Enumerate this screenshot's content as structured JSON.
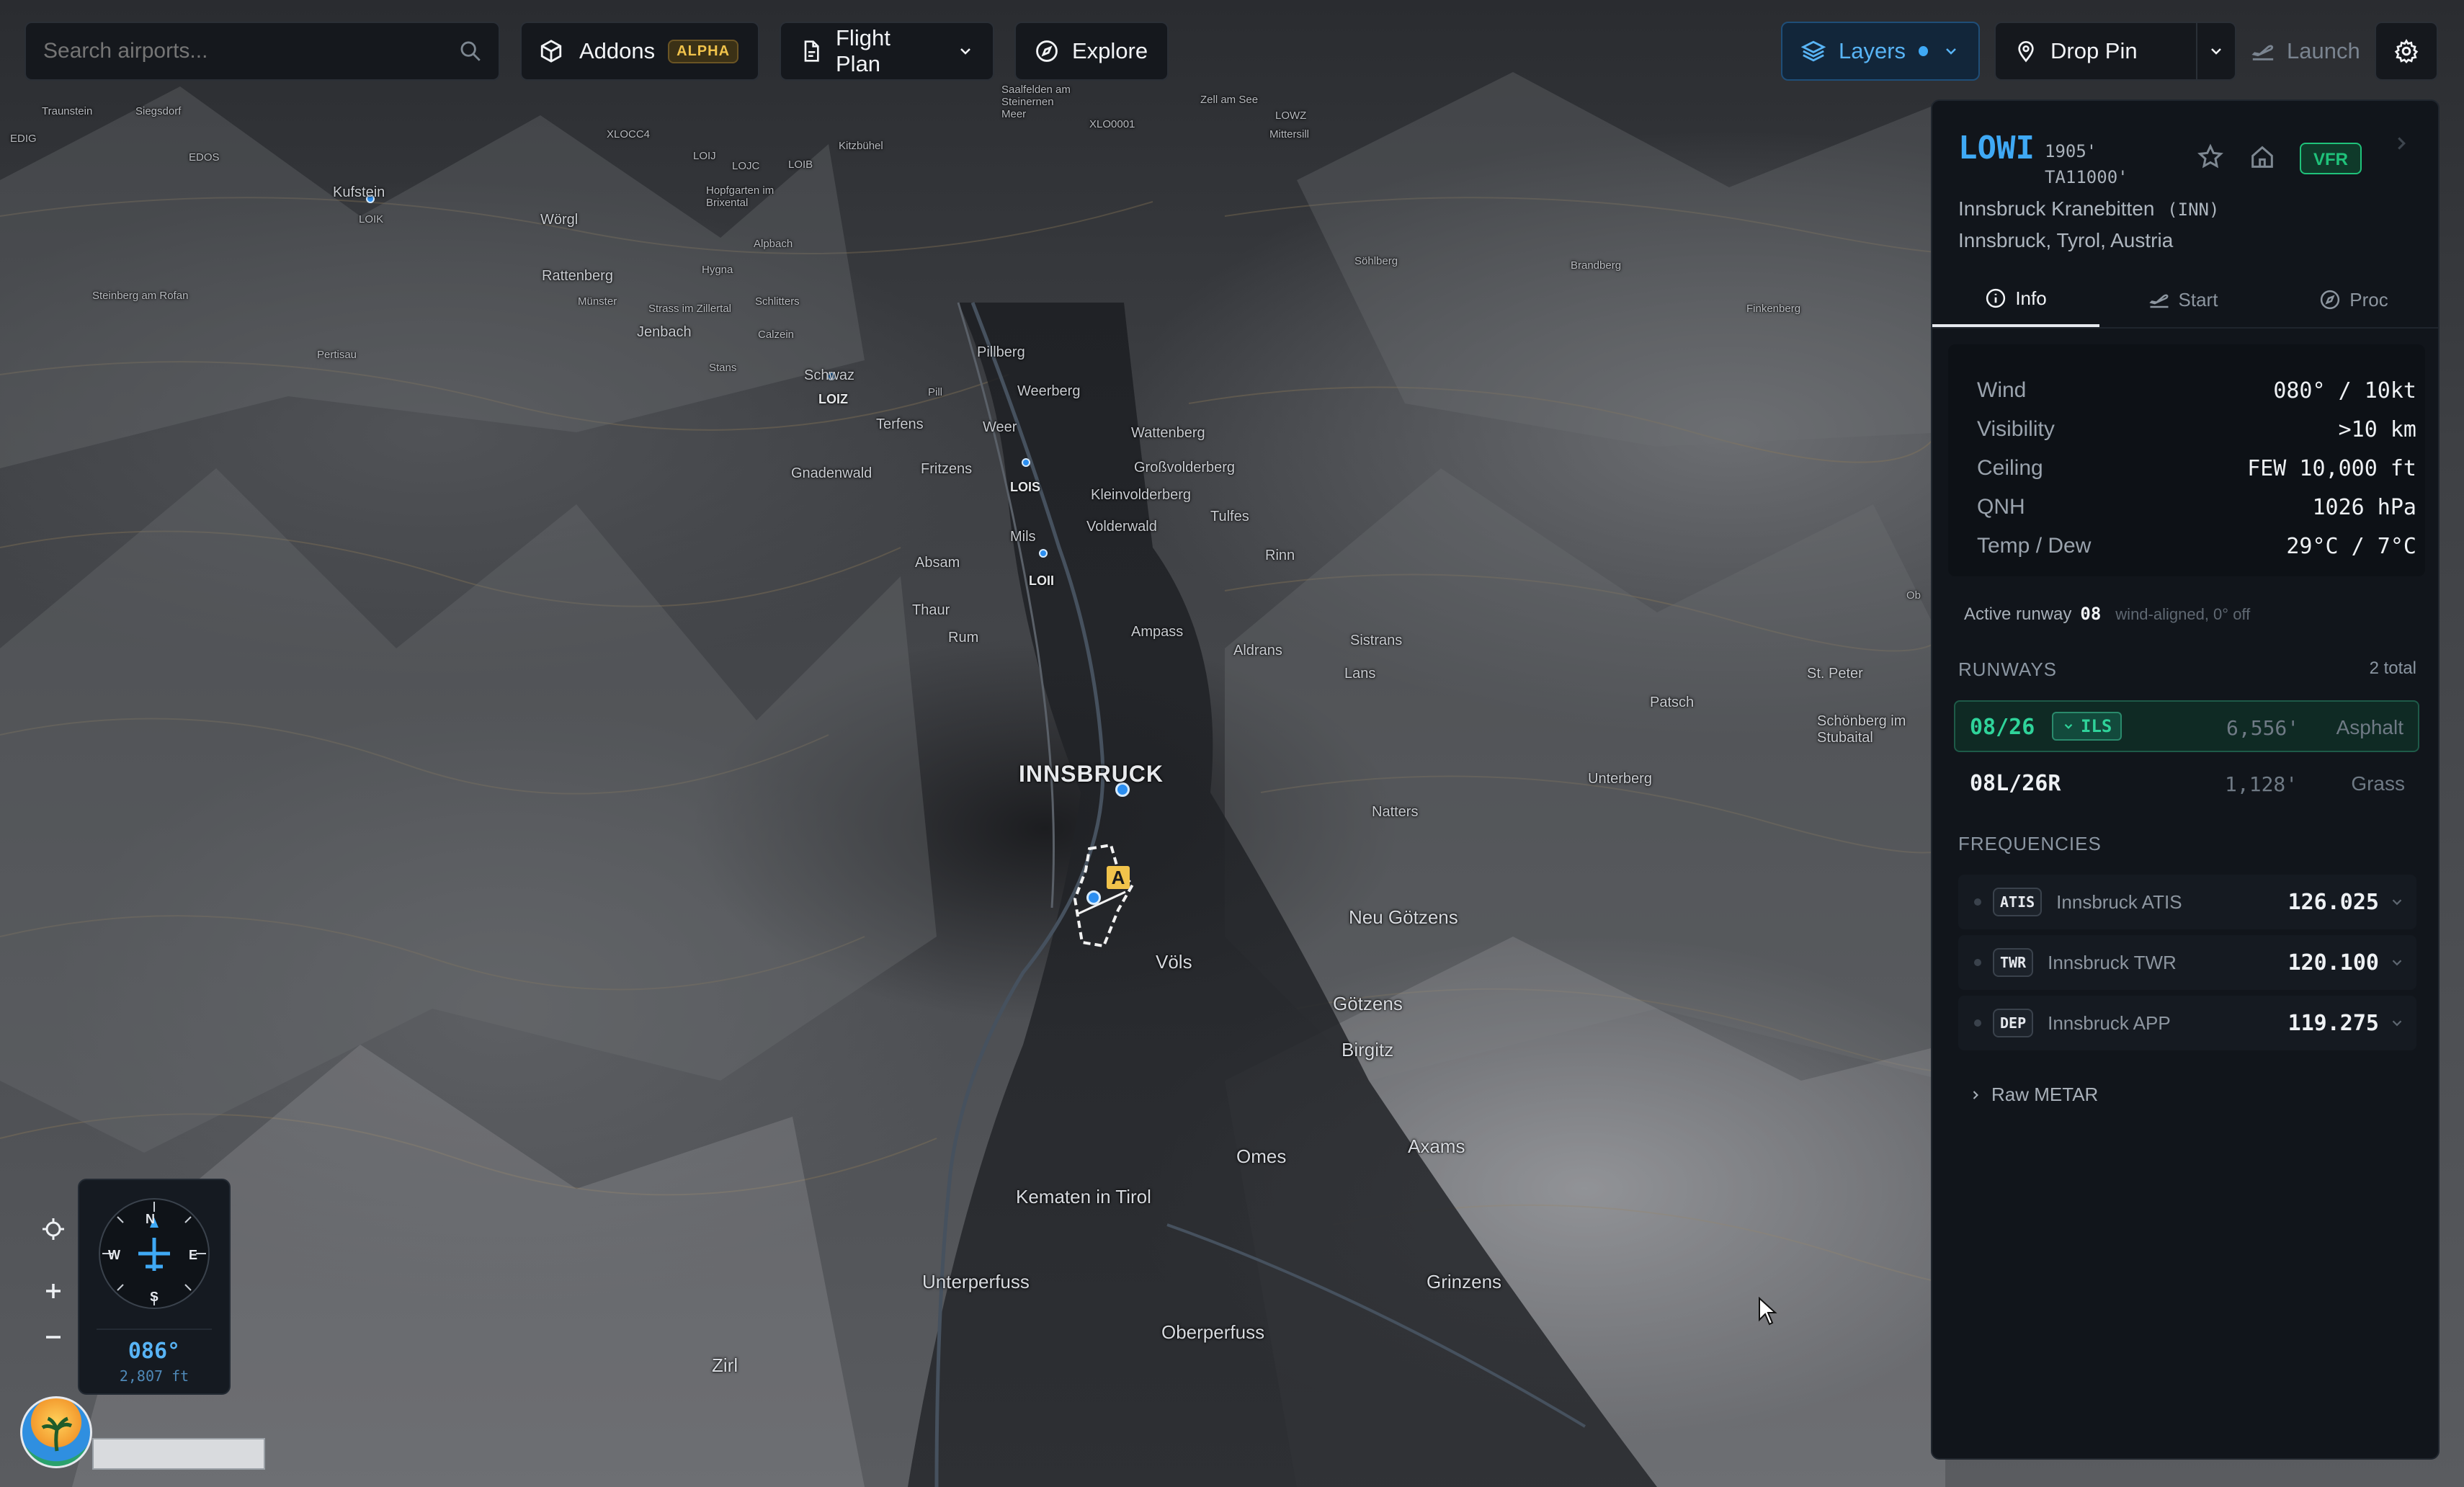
{
  "topbar": {
    "search_placeholder": "Search airports...",
    "addons_label": "Addons",
    "addons_badge": "ALPHA",
    "flightplan_label": "Flight Plan",
    "explore_label": "Explore",
    "layers_label": "Layers",
    "droppin_label": "Drop Pin",
    "launch_label": "Launch"
  },
  "map": {
    "city_label": "INNSBRUCK",
    "airport_marker": "A",
    "places": [
      {
        "name": "Traunstein"
      },
      {
        "name": "Siegsdorf"
      },
      {
        "name": "EDIG"
      },
      {
        "name": "EDOS"
      },
      {
        "name": "XLOCC4"
      },
      {
        "name": "Kufstein"
      },
      {
        "name": "LOIK"
      },
      {
        "name": "Wörgl"
      },
      {
        "name": "Rattenberg"
      },
      {
        "name": "Münster"
      },
      {
        "name": "Jenbach"
      },
      {
        "name": "Steinberg am Rofan"
      },
      {
        "name": "Pertisau"
      },
      {
        "name": "Strass im Zillertal"
      },
      {
        "name": "Schlitters"
      },
      {
        "name": "Calzein"
      },
      {
        "name": "Alpbach"
      },
      {
        "name": "Hygna"
      },
      {
        "name": "Stans"
      },
      {
        "name": "Schwaz"
      },
      {
        "name": "LOIZ"
      },
      {
        "name": "Pillberg"
      },
      {
        "name": "Pill"
      },
      {
        "name": "Weerberg"
      },
      {
        "name": "Terfens"
      },
      {
        "name": "Weer"
      },
      {
        "name": "Gnadenwald"
      },
      {
        "name": "Fritzens"
      },
      {
        "name": "LOIS"
      },
      {
        "name": "Wattenberg"
      },
      {
        "name": "Großvolderberg"
      },
      {
        "name": "Kleinvolderberg"
      },
      {
        "name": "Volderwald"
      },
      {
        "name": "Tulfes"
      },
      {
        "name": "Mils"
      },
      {
        "name": "Absam"
      },
      {
        "name": "LOII"
      },
      {
        "name": "Rinn"
      },
      {
        "name": "Thaur"
      },
      {
        "name": "Rum"
      },
      {
        "name": "Ampass"
      },
      {
        "name": "Aldrans"
      },
      {
        "name": "Sistrans"
      },
      {
        "name": "Lans"
      },
      {
        "name": "Natters"
      },
      {
        "name": "Unterberg"
      },
      {
        "name": "Patsch"
      },
      {
        "name": "St. Peter"
      },
      {
        "name": "Schönberg im Stubaital"
      },
      {
        "name": "Neu Götzens"
      },
      {
        "name": "Völs"
      },
      {
        "name": "Götzens"
      },
      {
        "name": "Birgitz"
      },
      {
        "name": "Axams"
      },
      {
        "name": "Omes"
      },
      {
        "name": "Kematen in Tirol"
      },
      {
        "name": "Unterperfuss"
      },
      {
        "name": "Oberperfuss"
      },
      {
        "name": "Grinzens"
      },
      {
        "name": "Zirl"
      },
      {
        "name": "Kitzbühel"
      },
      {
        "name": "LOIJ"
      },
      {
        "name": "LOJC"
      },
      {
        "name": "LOIB"
      },
      {
        "name": "Hopfgarten im Brixental"
      },
      {
        "name": "Saalfelden am Steinernen Meer"
      },
      {
        "name": "XLO0001"
      },
      {
        "name": "Zell am See"
      },
      {
        "name": "LOWZ"
      },
      {
        "name": "Mittersill"
      },
      {
        "name": "Söhlberg"
      },
      {
        "name": "Brandberg"
      },
      {
        "name": "Finkenberg"
      },
      {
        "name": "Ob"
      }
    ]
  },
  "nav": {
    "heading": "086°",
    "altitude": "2,807 ft",
    "compass_letters": [
      "N",
      "E",
      "S",
      "W"
    ]
  },
  "panel": {
    "icao": "LOWI",
    "elevation": "1905'",
    "transition": "TA11000'",
    "name": "Innsbruck Kranebitten",
    "iata": "(INN)",
    "location": "Innsbruck, Tyrol, Austria",
    "flight_rules": "VFR",
    "tabs": [
      {
        "label": "Info"
      },
      {
        "label": "Start"
      },
      {
        "label": "Proc"
      }
    ],
    "weather": [
      {
        "k": "Wind",
        "v": "080° / 10kt"
      },
      {
        "k": "Visibility",
        "v": ">10 km"
      },
      {
        "k": "Ceiling",
        "v": "FEW 10,000 ft"
      },
      {
        "k": "QNH",
        "v": "1026 hPa"
      },
      {
        "k": "Temp / Dew",
        "v": "29°C / 7°C"
      }
    ],
    "active_runway_label": "Active runway",
    "active_runway": "08",
    "active_runway_note": "wind-aligned, 0° off",
    "runways_title": "RUNWAYS",
    "runways_total": "2 total",
    "runways": [
      {
        "id": "08/26",
        "ils": "ILS",
        "length": "6,556'",
        "surface": "Asphalt"
      },
      {
        "id": "08L/26R",
        "length": "1,128'",
        "surface": "Grass"
      }
    ],
    "frequencies_title": "FREQUENCIES",
    "frequencies": [
      {
        "tag": "ATIS",
        "name": "Innsbruck ATIS",
        "freq": "126.025"
      },
      {
        "tag": "TWR",
        "name": "Innsbruck TWR",
        "freq": "120.100"
      },
      {
        "tag": "DEP",
        "name": "Innsbruck APP",
        "freq": "119.275"
      }
    ],
    "raw_metar_label": "Raw METAR"
  },
  "colors": {
    "accent": "#3fa9f5",
    "vfr": "#1fc27a",
    "alpha": "#f1c34b",
    "ils": "#2fd39a"
  }
}
